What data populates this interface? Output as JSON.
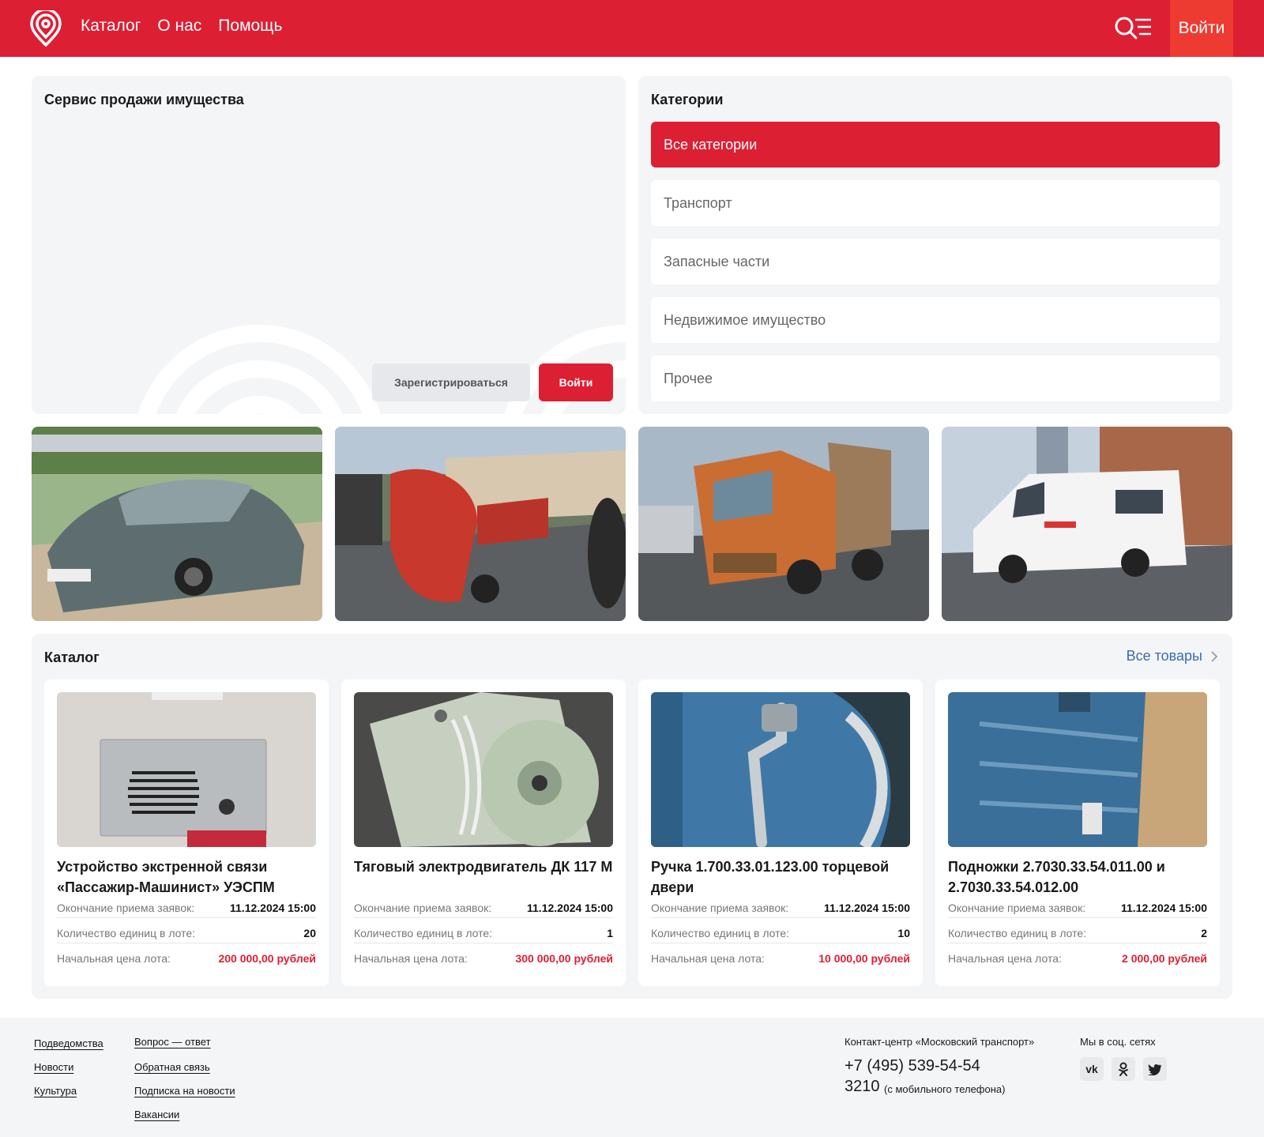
{
  "header": {
    "nav": [
      "Каталог",
      "О нас",
      "Помощь"
    ],
    "login": "Войти",
    "brand_color": "#dc1f33"
  },
  "hero": {
    "title": "Сервис продажи имущества",
    "register": "Зарегистрироваться",
    "login": "Войти"
  },
  "categories": {
    "title": "Категории",
    "items": [
      "Все категории",
      "Транспорт",
      "Запасные части",
      "Недвижимое имущество",
      "Прочее"
    ],
    "active_index": 0
  },
  "gallery": {
    "images": [
      "car-photo",
      "sweeper-photo",
      "dump-truck-photo",
      "ambulance-van-photo"
    ]
  },
  "catalog": {
    "title": "Каталог",
    "all_link": "Все товары",
    "labels": {
      "deadline": "Окончание приема заявок:",
      "qty": "Количество единиц в лоте:",
      "price": "Начальная цена лота:"
    },
    "cards": [
      {
        "title": "Устройство экстренной связи «Пассажир-Машинист» УЭСПМ",
        "deadline": "11.12.2024 15:00",
        "qty": "20",
        "price": "200 000,00 рублей"
      },
      {
        "title": "Тяговый электродвигатель ДК 117 М",
        "deadline": "11.12.2024 15:00",
        "qty": "1",
        "price": "300 000,00 рублей"
      },
      {
        "title": "Ручка 1.700.33.01.123.00 торцевой двери",
        "deadline": "11.12.2024 15:00",
        "qty": "10",
        "price": "10 000,00 рублей"
      },
      {
        "title": "Подножки 2.7030.33.54.011.00 и 2.7030.33.54.012.00",
        "deadline": "11.12.2024 15:00",
        "qty": "2",
        "price": "2 000,00 рублей"
      }
    ]
  },
  "footer": {
    "col1": [
      "Подведомства",
      "Новости",
      "Культура"
    ],
    "col2": [
      "Вопрос — ответ",
      "Обратная связь",
      "Подписка на новости",
      "Вакансии"
    ],
    "contact_title": "Контакт-центр «Московский транспорт»",
    "phone": "+7 (495) 539-54-54",
    "short_number": "3210",
    "short_note": "(с мобильного телефона)",
    "social_title": "Мы в соц. сетях",
    "social": [
      "vk-icon",
      "ok-icon",
      "twitter-icon"
    ]
  }
}
